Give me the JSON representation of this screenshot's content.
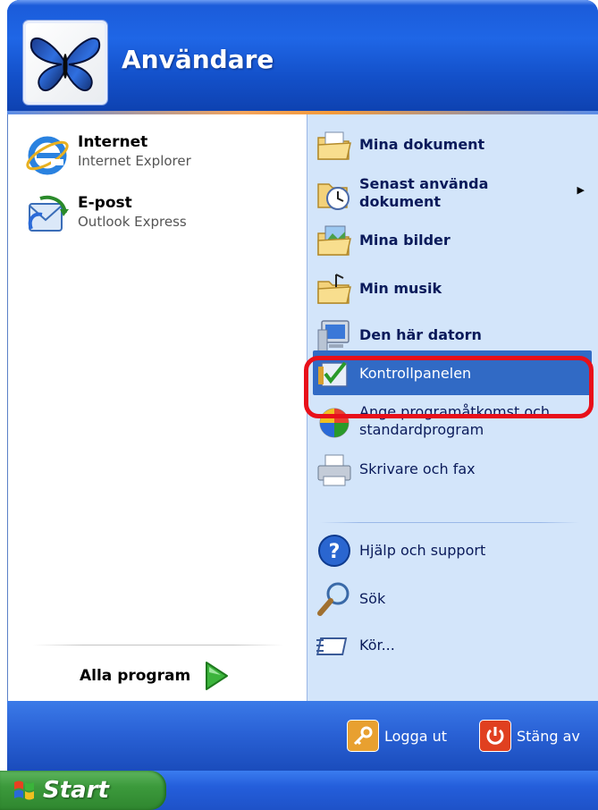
{
  "user": {
    "name": "Användare"
  },
  "pinned": [
    {
      "title": "Internet",
      "subtitle": "Internet Explorer",
      "icon": "internet-explorer-icon"
    },
    {
      "title": "E-post",
      "subtitle": "Outlook Express",
      "icon": "outlook-express-icon"
    }
  ],
  "all_programs": {
    "label": "Alla program",
    "icon": "green-arrow-icon"
  },
  "right": {
    "items": [
      {
        "label": "Mina dokument",
        "bold": true,
        "icon": "my-documents-icon"
      },
      {
        "label": "Senast använda\ndokument",
        "bold": true,
        "icon": "recent-documents-icon",
        "submenu": true
      },
      {
        "label": "Mina bilder",
        "bold": true,
        "icon": "my-pictures-icon"
      },
      {
        "label": "Min musik",
        "bold": true,
        "icon": "my-music-icon"
      },
      {
        "label": "Den här datorn",
        "bold": true,
        "icon": "my-computer-icon"
      },
      {
        "label": "Kontrollpanelen",
        "bold": false,
        "icon": "control-panel-icon",
        "highlighted": true
      },
      {
        "label": "Ange programåtkomst och\nstandardprogram",
        "bold": false,
        "icon": "program-access-icon"
      },
      {
        "label": "Skrivare och fax",
        "bold": false,
        "icon": "printer-icon"
      },
      {
        "label": "Hjälp och support",
        "bold": false,
        "icon": "help-icon"
      },
      {
        "label": "Sök",
        "bold": false,
        "icon": "search-icon"
      },
      {
        "label": "Kör...",
        "bold": false,
        "icon": "run-icon"
      }
    ]
  },
  "bottom": {
    "logoff": {
      "label": "Logga ut",
      "icon": "key-icon"
    },
    "shutdown": {
      "label": "Stäng av",
      "icon": "power-icon"
    }
  },
  "taskbar": {
    "start_label": "Start",
    "icon": "windows-flag-icon"
  },
  "colors": {
    "highlight": "#316ac5",
    "annotation_ring": "#e8101a",
    "right_pane": "#d3e5fa"
  }
}
